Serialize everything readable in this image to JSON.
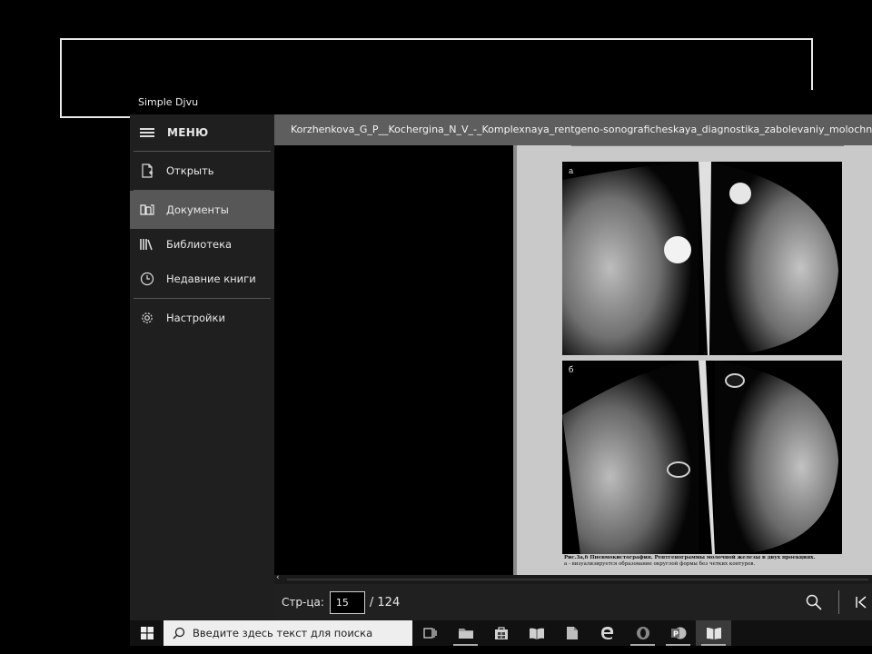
{
  "app": {
    "title": "Simple Djvu"
  },
  "sidebar": {
    "menu_label": "МЕНЮ",
    "items": [
      {
        "label": "Открыть",
        "icon": "open-file-icon"
      },
      {
        "label": "Документы",
        "icon": "documents-icon",
        "active": true
      },
      {
        "label": "Библиотека",
        "icon": "library-icon"
      },
      {
        "label": "Недавние книги",
        "icon": "clock-icon"
      },
      {
        "label": "Настройки",
        "icon": "gear-icon"
      }
    ]
  },
  "document": {
    "filename": "Korzhenkova_G_P__Kochergina_N_V_-_Komplexnaya_rentgeno-sonograficheskaya_diagnostika_zabolevaniy_molochnoy_zhelezy",
    "scan_a_label": "а",
    "scan_b_label": "б",
    "caption_line1": "Рис.3а,б Пневмокистография. Рентгенограммы молочной железы в двух проекциях.",
    "caption_line2": "а - визуализируется образование округлой формы без четких контуров."
  },
  "pager": {
    "label": "Стр-ца:",
    "current": "15",
    "total": "/ 124"
  },
  "taskbar": {
    "search_placeholder": "Введите здесь текст для поиска",
    "icons": [
      "task-view-icon",
      "file-explorer-icon",
      "store-icon",
      "reader-icon",
      "document-icon",
      "edge-icon",
      "opera-icon",
      "powerpoint-icon",
      "djvu-reader-icon"
    ]
  },
  "colors": {
    "sidebar_bg": "#1f1f1f",
    "active_item": "#575757",
    "header_bg": "#5e5e5e"
  }
}
